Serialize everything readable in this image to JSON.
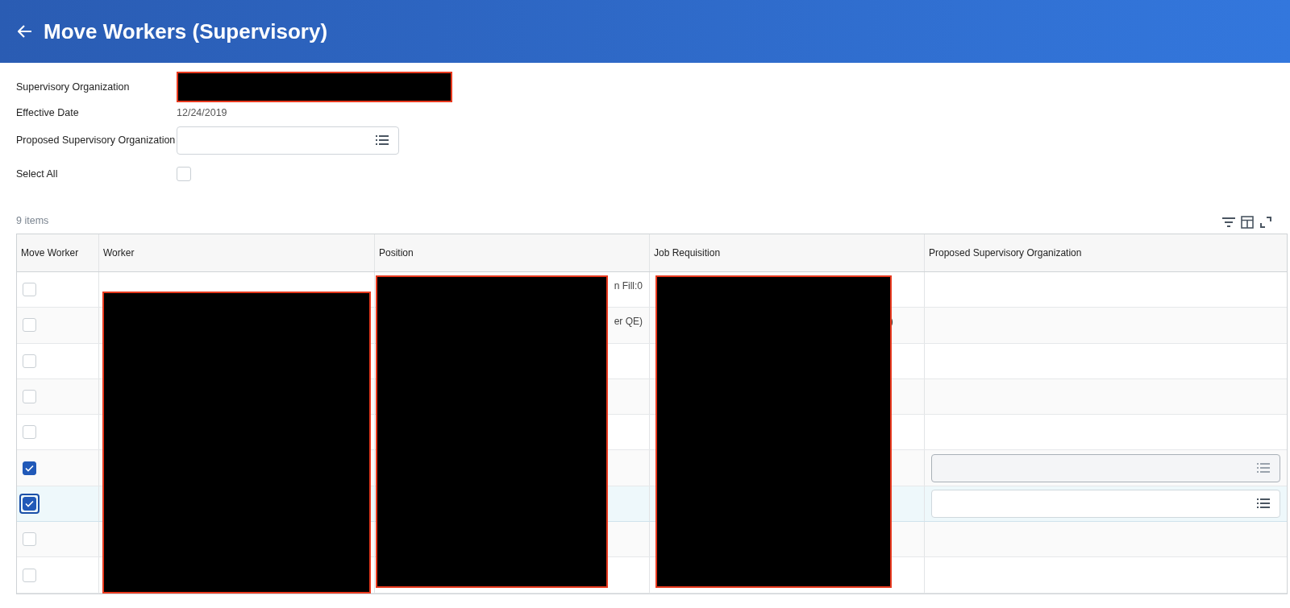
{
  "header": {
    "title": "Move Workers (Supervisory)"
  },
  "form": [
    {
      "kind": "redacted",
      "label": "Supervisory Organization"
    },
    {
      "kind": "text",
      "label": "Effective Date",
      "value": "12/24/2019"
    },
    {
      "kind": "prompt",
      "label": "Proposed Supervisory Organization"
    },
    {
      "kind": "checkbox",
      "label": "Select All",
      "checked": false
    }
  ],
  "table": {
    "count": "9 items",
    "columns": [
      {
        "label": "Move Worker"
      },
      {
        "label": "Worker",
        "redacted": true
      },
      {
        "label": "Position",
        "redacted": true
      },
      {
        "label": "Job Requisition",
        "redacted": true
      },
      {
        "label": "Proposed Supervisory Organization"
      }
    ],
    "rows": [
      {
        "checked": false,
        "selected": false,
        "position": "n Fill:0"
      },
      {
        "checked": false,
        "selected": false,
        "position": "er QE)",
        "job_requisition": ")"
      },
      {
        "checked": false,
        "selected": false
      },
      {
        "checked": false,
        "selected": false
      },
      {
        "checked": false,
        "selected": false
      },
      {
        "checked": true,
        "selected": false,
        "field": {
          "disabled": true
        }
      },
      {
        "checked": true,
        "selected": true,
        "field": {
          "disabled": false
        }
      },
      {
        "checked": false,
        "selected": false
      },
      {
        "checked": false,
        "selected": false
      }
    ]
  }
}
